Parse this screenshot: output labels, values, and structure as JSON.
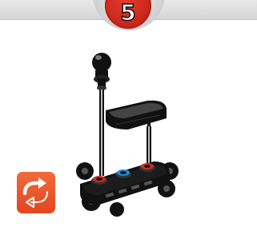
{
  "step": {
    "number": "5"
  },
  "controls": {
    "rotate_icon": "rotate-view-icon",
    "rotate_color": "#e8522a"
  },
  "colors": {
    "step_badge": "#c8261b",
    "part_dark": "#111111",
    "stud_red": "#d22a22",
    "stud_blue": "#1a8fd6"
  }
}
